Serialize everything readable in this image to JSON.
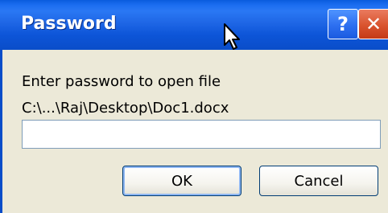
{
  "window": {
    "title": "Password",
    "help_label": "?",
    "close_label": "✕"
  },
  "dialog": {
    "prompt": "Enter password to open file",
    "file_path": "C:\\...\\Raj\\Desktop\\Doc1.docx",
    "password_value": ""
  },
  "buttons": {
    "ok_label": "OK",
    "cancel_label": "Cancel"
  },
  "colors": {
    "titlebar": "#0a4dc9",
    "dialog_bg": "#ece9d8",
    "close_red": "#d9532e"
  }
}
